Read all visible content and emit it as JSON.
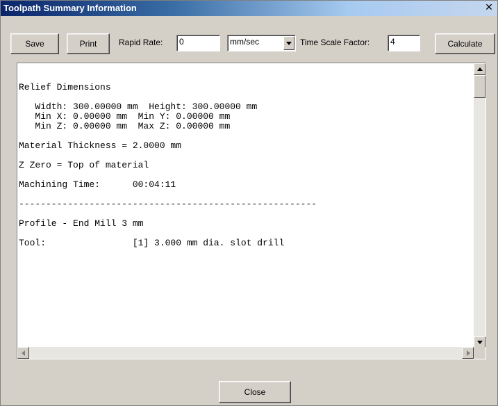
{
  "window": {
    "title": "Toolpath Summary Information",
    "close_glyph": "✕"
  },
  "toolbar": {
    "save_label": "Save",
    "print_label": "Print",
    "rapid_rate_label": "Rapid Rate:",
    "rapid_rate_value": "0",
    "units_value": "mm/sec",
    "time_scale_label": "Time Scale Factor:",
    "time_scale_value": "4",
    "calculate_label": "Calculate"
  },
  "summary_lines": [
    "Relief Dimensions",
    "",
    "   Width: 300.00000 mm  Height: 300.00000 mm",
    "   Min X: 0.00000 mm  Min Y: 0.00000 mm",
    "   Min Z: 0.00000 mm  Max Z: 0.00000 mm",
    "",
    "Material Thickness = 2.0000 mm",
    "",
    "Z Zero = Top of material",
    "",
    "Machining Time:      00:04:11",
    "",
    "-------------------------------------------------------",
    "",
    "Profile - End Mill 3 mm",
    "",
    "Tool:                [1] 3.000 mm dia. slot drill"
  ],
  "footer": {
    "close_label": "Close"
  },
  "icons": {
    "scroll_up": "scroll-up-arrow-icon",
    "scroll_down": "scroll-down-arrow-icon",
    "scroll_left": "scroll-left-arrow-icon",
    "scroll_right": "scroll-right-arrow-icon",
    "dropdown": "dropdown-arrow-icon"
  }
}
